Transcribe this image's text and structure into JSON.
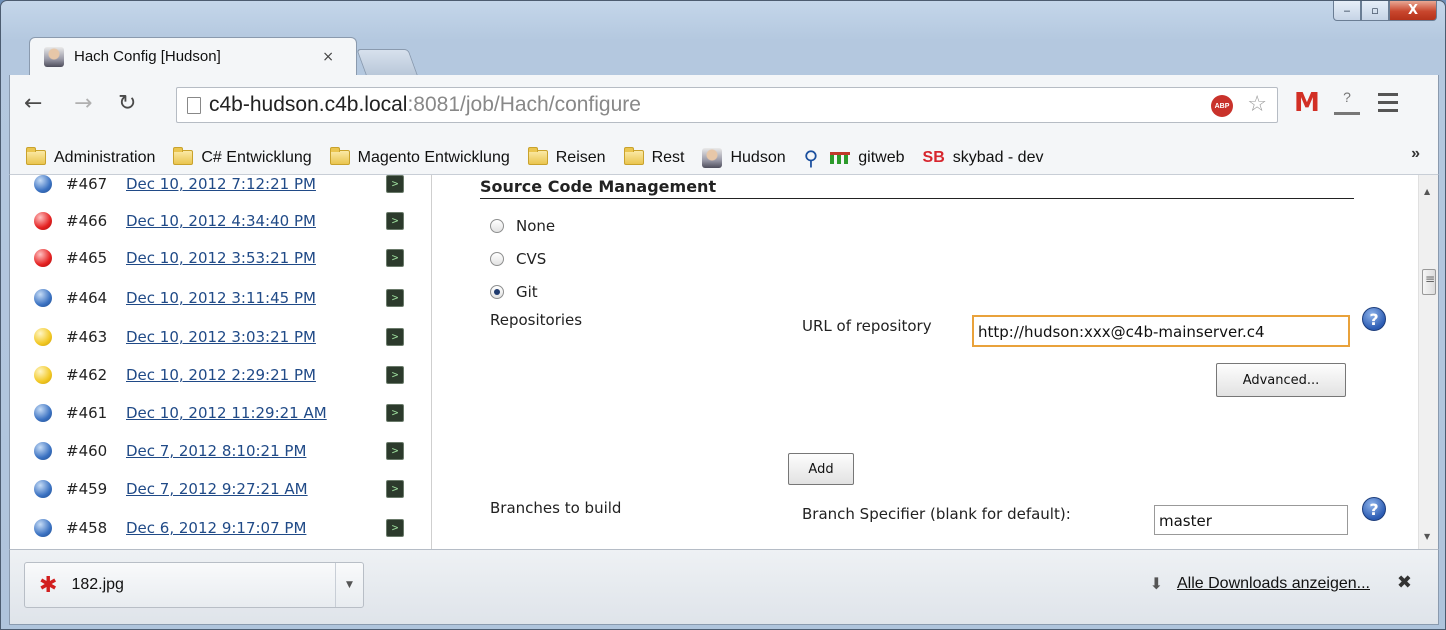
{
  "window": {
    "minimize_label": "‒",
    "maximize_label": "▫",
    "close_label": "X"
  },
  "tab": {
    "title": "Hach Config [Hudson]",
    "close_label": "×"
  },
  "toolbar": {
    "url_host": "c4b-hudson.c4b.local",
    "url_rest": ":8081/job/Hach/configure",
    "abp_label": "ABP",
    "gmail_label": "M"
  },
  "bookmarks": {
    "items": [
      {
        "label": "Administration",
        "icon": "folder-icon"
      },
      {
        "label": "C# Entwicklung",
        "icon": "folder-icon"
      },
      {
        "label": "Magento Entwicklung",
        "icon": "folder-icon"
      },
      {
        "label": "Reisen",
        "icon": "folder-icon"
      },
      {
        "label": "Rest",
        "icon": "folder-icon"
      },
      {
        "label": "Hudson",
        "icon": "hudson-icon"
      },
      {
        "label": "gitweb",
        "icon": "gitweb-icon"
      },
      {
        "label": "skybad - dev",
        "icon": "sb-icon",
        "badge": "SB"
      }
    ],
    "more_label": "»"
  },
  "builds": [
    {
      "number": "#467",
      "date": "Dec 10, 2012 7:12:21 PM",
      "status": "blue"
    },
    {
      "number": "#466",
      "date": "Dec 10, 2012 4:34:40 PM",
      "status": "red"
    },
    {
      "number": "#465",
      "date": "Dec 10, 2012 3:53:21 PM",
      "status": "red"
    },
    {
      "number": "#464",
      "date": "Dec 10, 2012 3:11:45 PM",
      "status": "blue"
    },
    {
      "number": "#463",
      "date": "Dec 10, 2012 3:03:21 PM",
      "status": "yellow"
    },
    {
      "number": "#462",
      "date": "Dec 10, 2012 2:29:21 PM",
      "status": "yellow"
    },
    {
      "number": "#461",
      "date": "Dec 10, 2012 11:29:21 AM",
      "status": "blue"
    },
    {
      "number": "#460",
      "date": "Dec 7, 2012 8:10:21 PM",
      "status": "blue"
    },
    {
      "number": "#459",
      "date": "Dec 7, 2012 9:27:21 AM",
      "status": "blue"
    },
    {
      "number": "#458",
      "date": "Dec 6, 2012 9:17:07 PM",
      "status": "blue"
    }
  ],
  "scm": {
    "title": "Source Code Management",
    "options": [
      {
        "label": "None",
        "checked": false
      },
      {
        "label": "CVS",
        "checked": false
      },
      {
        "label": "Git",
        "checked": true
      }
    ],
    "repositories_label": "Repositories",
    "url_label": "URL of repository",
    "url_value": "http://hudson:xxx@c4b-mainserver.c4",
    "advanced_label": "Advanced...",
    "add_label": "Add",
    "branches_label": "Branches to build",
    "branch_spec_label": "Branch Specifier (blank for default):",
    "branch_value": "master",
    "help_label": "?"
  },
  "downloads": {
    "file_name": "182.jpg",
    "all_label": "Alle Downloads anzeigen...",
    "close_label": "✖"
  }
}
